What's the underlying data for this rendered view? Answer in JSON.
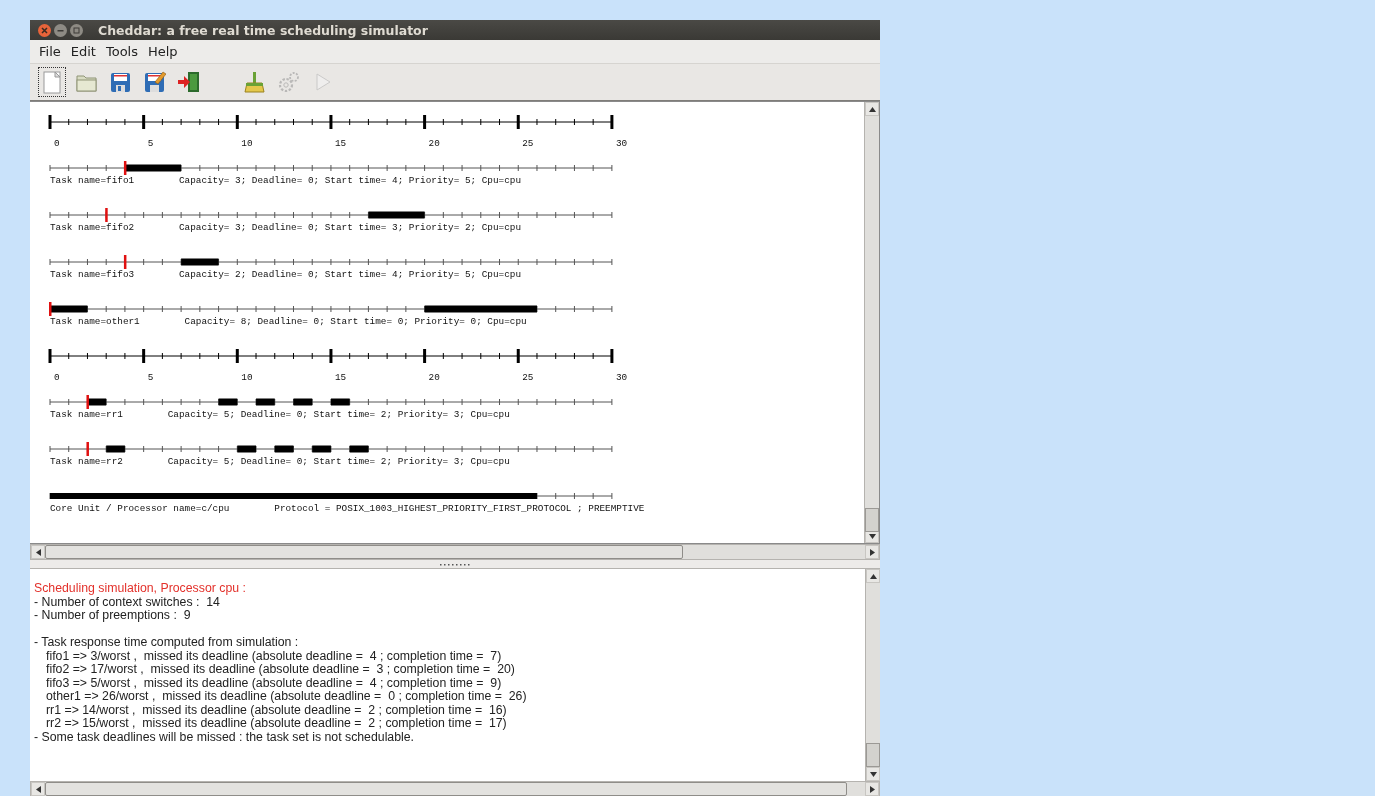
{
  "window": {
    "title": "Cheddar: a free real time scheduling simulator",
    "controls": [
      {
        "kind": "close"
      },
      {
        "kind": "minimize"
      },
      {
        "kind": "maximize"
      }
    ]
  },
  "menu": [
    {
      "label": "File"
    },
    {
      "label": "Edit"
    },
    {
      "label": "Tools"
    },
    {
      "label": "Help"
    }
  ],
  "toolbar": {
    "groups": [
      [
        {
          "kind": "new",
          "disabled": false,
          "focused": true
        },
        {
          "kind": "open",
          "disabled": false,
          "focused": false
        },
        {
          "kind": "save",
          "disabled": false,
          "focused": false
        },
        {
          "kind": "save_as",
          "disabled": false,
          "focused": false
        },
        {
          "kind": "exit",
          "disabled": false,
          "focused": false
        }
      ],
      [
        {
          "kind": "clean",
          "disabled": false,
          "focused": false
        },
        {
          "kind": "settings",
          "disabled": true,
          "focused": false
        },
        {
          "kind": "run",
          "disabled": true,
          "focused": false
        }
      ]
    ]
  },
  "schedule": {
    "rows": [
      {
        "kind": "axis",
        "ticks": [
          "0",
          "5",
          "10",
          "15",
          "20",
          "25",
          "30"
        ]
      },
      {
        "kind": "task",
        "name_label": "Task name=fifo1",
        "details": "Capacity= 3; Deadline= 0; Start time= 4; Priority= 5; Cpu=cpu"
      },
      {
        "kind": "task",
        "name_label": "Task name=fifo2",
        "details": "Capacity= 3; Deadline= 0; Start time= 3; Priority= 2; Cpu=cpu"
      },
      {
        "kind": "task",
        "name_label": "Task name=fifo3",
        "details": "Capacity= 2; Deadline= 0; Start time= 4; Priority= 5; Cpu=cpu"
      },
      {
        "kind": "task",
        "name_label": "Task name=other1",
        "details": "Capacity= 8; Deadline= 0; Start time= 0; Priority= 0; Cpu=cpu"
      },
      {
        "kind": "axis",
        "ticks": [
          "0",
          "5",
          "10",
          "15",
          "20",
          "25",
          "30"
        ]
      },
      {
        "kind": "task",
        "name_label": "Task name=rr1",
        "details": "Capacity= 5; Deadline= 0; Start time= 2; Priority= 3; Cpu=cpu"
      },
      {
        "kind": "task",
        "name_label": "Task name=rr2",
        "details": "Capacity= 5; Deadline= 0; Start time= 2; Priority= 3; Cpu=cpu"
      },
      {
        "kind": "processor",
        "name_label": "Core Unit / Processor name=c/cpu",
        "details": "Protocol = POSIX_1003_HIGHEST_PRIORITY_FIRST_PROTOCOL ; PREEMPTIVE"
      }
    ]
  },
  "report": {
    "lines": [
      {
        "kind": "heading",
        "text": "Scheduling simulation, Processor cpu :"
      },
      {
        "kind": "line",
        "text": "- Number of context switches :  14"
      },
      {
        "kind": "line",
        "text": "- Number of preemptions :  9"
      },
      {
        "kind": "section",
        "text": "- Task response time computed from simulation :"
      },
      {
        "kind": "item",
        "text": "fifo1 => 3/worst ,  missed its deadline (absolute deadline =  4 ; completion time =  7)"
      },
      {
        "kind": "item",
        "text": "fifo2 => 17/worst ,  missed its deadline (absolute deadline =  3 ; completion time =  20)"
      },
      {
        "kind": "item",
        "text": "fifo3 => 5/worst ,  missed its deadline (absolute deadline =  4 ; completion time =  9)"
      },
      {
        "kind": "item",
        "text": "other1 => 26/worst ,  missed its deadline (absolute deadline =  0 ; completion time =  26)"
      },
      {
        "kind": "item",
        "text": "rr1 => 14/worst ,  missed its deadline (absolute deadline =  2 ; completion time =  16)"
      },
      {
        "kind": "item",
        "text": "rr2 => 15/worst ,  missed its deadline (absolute deadline =  2 ; completion time =  17)"
      },
      {
        "kind": "line",
        "text": "- Some task deadlines will be missed : the task set is not schedulable."
      }
    ]
  }
}
